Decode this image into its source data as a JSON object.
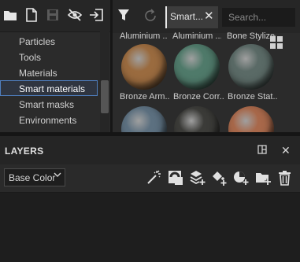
{
  "assets": {
    "categories": [
      {
        "label": "Particles",
        "selected": false
      },
      {
        "label": "Tools",
        "selected": false
      },
      {
        "label": "Materials",
        "selected": false
      },
      {
        "label": "Smart materials",
        "selected": true
      },
      {
        "label": "Smart masks",
        "selected": false
      },
      {
        "label": "Environments",
        "selected": false
      }
    ],
    "toolbar_icons": [
      "folder-icon",
      "new-file-icon",
      "save-icon",
      "hidden-eye-icon",
      "export-icon"
    ]
  },
  "browser": {
    "filter_tab_label": "Smart...",
    "search_placeholder": "Search...",
    "top_row_labels": [
      "Aluminium ...",
      "Aluminium ...",
      "Bone Stylized"
    ],
    "row1_labels": [
      "Bronze Arm...",
      "Bronze Corr...",
      "Bronze Stat..."
    ],
    "colors": {
      "row1": [
        "#9a6b3f",
        "#4f7a6a",
        "#5a6a66"
      ],
      "row2": [
        "#5c7080",
        "#3b3b38",
        "#a8684a"
      ]
    }
  },
  "layers": {
    "title": "LAYERS",
    "channel": "Base Color",
    "toolbar_icons": [
      "magic-wand-icon",
      "mask-icon",
      "add-layer-icon",
      "fill-layer-icon",
      "effect-icon",
      "add-folder-icon",
      "delete-icon"
    ]
  }
}
